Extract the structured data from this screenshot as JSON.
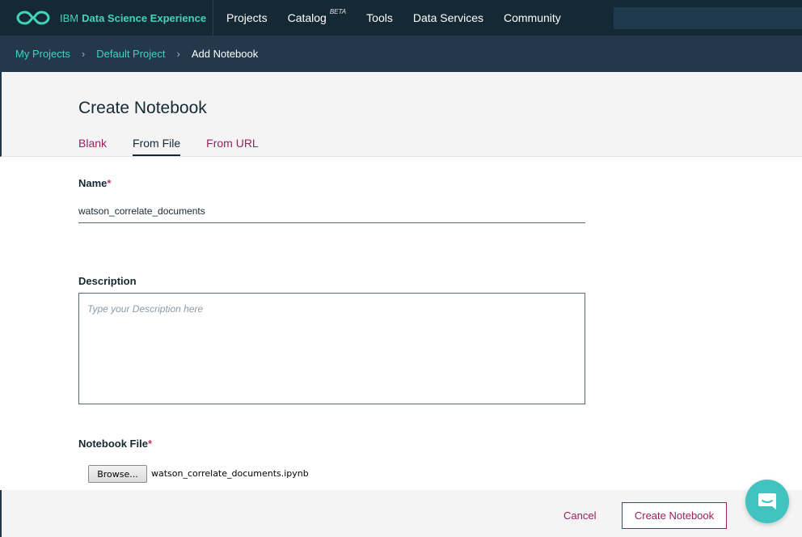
{
  "brand": {
    "prefix": "IBM",
    "name": "Data Science Experience"
  },
  "nav": {
    "items": [
      {
        "label": "Projects"
      },
      {
        "label": "Catalog",
        "badge": "BETA"
      },
      {
        "label": "Tools"
      },
      {
        "label": "Data Services"
      },
      {
        "label": "Community"
      }
    ]
  },
  "breadcrumb": {
    "items": [
      "My Projects",
      "Default Project"
    ],
    "current": "Add Notebook"
  },
  "page": {
    "title": "Create Notebook",
    "tabs": [
      {
        "label": "Blank",
        "active": false
      },
      {
        "label": "From File",
        "active": true
      },
      {
        "label": "From URL",
        "active": false
      }
    ]
  },
  "form": {
    "name_label": "Name",
    "name_value": "watson_correlate_documents",
    "description_label": "Description",
    "description_placeholder": "Type your Description here",
    "file_label": "Notebook File",
    "required_mark": "*",
    "browse_label": "Browse...",
    "file_name": "watson_correlate_documents.ipynb"
  },
  "footer": {
    "cancel_label": "Cancel",
    "create_label": "Create Notebook"
  },
  "colors": {
    "topbar": "#152935",
    "subbar": "#23394b",
    "accent_teal": "#46d1bf",
    "accent_magenta": "#9b1f5d",
    "chat": "#41c4c0"
  }
}
